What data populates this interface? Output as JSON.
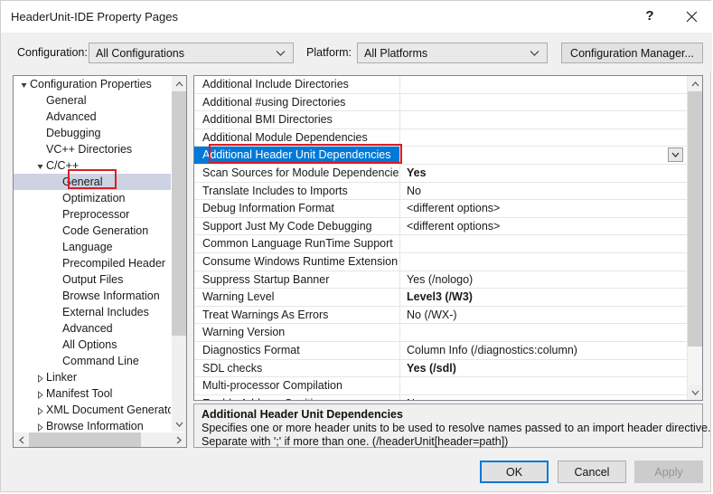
{
  "window": {
    "title": "HeaderUnit-IDE Property Pages",
    "help_glyph": "?",
    "close_glyph": "✕"
  },
  "config_bar": {
    "configuration_label": "Configuration:",
    "configuration_value": "All Configurations",
    "platform_label": "Platform:",
    "platform_value": "All Platforms",
    "configuration_manager_label": "Configuration Manager..."
  },
  "tree": {
    "items": [
      {
        "label": "Configuration Properties",
        "indent": 0,
        "twisty": "expanded",
        "selected": false
      },
      {
        "label": "General",
        "indent": 1,
        "twisty": "none",
        "selected": false
      },
      {
        "label": "Advanced",
        "indent": 1,
        "twisty": "none",
        "selected": false
      },
      {
        "label": "Debugging",
        "indent": 1,
        "twisty": "none",
        "selected": false
      },
      {
        "label": "VC++ Directories",
        "indent": 1,
        "twisty": "none",
        "selected": false
      },
      {
        "label": "C/C++",
        "indent": 1,
        "twisty": "expanded",
        "selected": false
      },
      {
        "label": "General",
        "indent": 2,
        "twisty": "none",
        "selected": true
      },
      {
        "label": "Optimization",
        "indent": 2,
        "twisty": "none",
        "selected": false
      },
      {
        "label": "Preprocessor",
        "indent": 2,
        "twisty": "none",
        "selected": false
      },
      {
        "label": "Code Generation",
        "indent": 2,
        "twisty": "none",
        "selected": false
      },
      {
        "label": "Language",
        "indent": 2,
        "twisty": "none",
        "selected": false
      },
      {
        "label": "Precompiled Header",
        "indent": 2,
        "twisty": "none",
        "selected": false
      },
      {
        "label": "Output Files",
        "indent": 2,
        "twisty": "none",
        "selected": false
      },
      {
        "label": "Browse Information",
        "indent": 2,
        "twisty": "none",
        "selected": false
      },
      {
        "label": "External Includes",
        "indent": 2,
        "twisty": "none",
        "selected": false
      },
      {
        "label": "Advanced",
        "indent": 2,
        "twisty": "none",
        "selected": false
      },
      {
        "label": "All Options",
        "indent": 2,
        "twisty": "none",
        "selected": false
      },
      {
        "label": "Command Line",
        "indent": 2,
        "twisty": "none",
        "selected": false
      },
      {
        "label": "Linker",
        "indent": 1,
        "twisty": "collapsed",
        "selected": false
      },
      {
        "label": "Manifest Tool",
        "indent": 1,
        "twisty": "collapsed",
        "selected": false
      },
      {
        "label": "XML Document Generator",
        "indent": 1,
        "twisty": "collapsed",
        "selected": false
      },
      {
        "label": "Browse Information",
        "indent": 1,
        "twisty": "collapsed",
        "selected": false
      }
    ]
  },
  "grid": {
    "rows": [
      {
        "name": "Additional Include Directories",
        "value": "",
        "bold": false,
        "selected": false
      },
      {
        "name": "Additional #using Directories",
        "value": "",
        "bold": false,
        "selected": false
      },
      {
        "name": "Additional BMI Directories",
        "value": "",
        "bold": false,
        "selected": false
      },
      {
        "name": "Additional Module Dependencies",
        "value": "",
        "bold": false,
        "selected": false
      },
      {
        "name": "Additional Header Unit Dependencies",
        "value": "",
        "bold": false,
        "selected": true
      },
      {
        "name": "Scan Sources for Module Dependencies",
        "value": "Yes",
        "bold": true,
        "selected": false
      },
      {
        "name": "Translate Includes to Imports",
        "value": "No",
        "bold": false,
        "selected": false
      },
      {
        "name": "Debug Information Format",
        "value": "<different options>",
        "bold": false,
        "selected": false
      },
      {
        "name": "Support Just My Code Debugging",
        "value": "<different options>",
        "bold": false,
        "selected": false
      },
      {
        "name": "Common Language RunTime Support",
        "value": "",
        "bold": false,
        "selected": false
      },
      {
        "name": "Consume Windows Runtime Extension",
        "value": "",
        "bold": false,
        "selected": false
      },
      {
        "name": "Suppress Startup Banner",
        "value": "Yes (/nologo)",
        "bold": false,
        "selected": false
      },
      {
        "name": "Warning Level",
        "value": "Level3 (/W3)",
        "bold": true,
        "selected": false
      },
      {
        "name": "Treat Warnings As Errors",
        "value": "No (/WX-)",
        "bold": false,
        "selected": false
      },
      {
        "name": "Warning Version",
        "value": "",
        "bold": false,
        "selected": false
      },
      {
        "name": "Diagnostics Format",
        "value": "Column Info (/diagnostics:column)",
        "bold": false,
        "selected": false
      },
      {
        "name": "SDL checks",
        "value": "Yes (/sdl)",
        "bold": true,
        "selected": false
      },
      {
        "name": "Multi-processor Compilation",
        "value": "",
        "bold": false,
        "selected": false
      },
      {
        "name": "Enable Address Sanitizer",
        "value": "No",
        "bold": false,
        "selected": false
      }
    ]
  },
  "description": {
    "title": "Additional Header Unit Dependencies",
    "line1": "Specifies one or more header units to be used to resolve names passed to an import header directive.",
    "line2": "Separate with ';' if more than one.  (/headerUnit[header=path])"
  },
  "footer": {
    "ok_label": "OK",
    "cancel_label": "Cancel",
    "apply_label": "Apply"
  },
  "colors": {
    "selection_blue": "#0078d7",
    "highlight_red": "#e01b24",
    "tree_selection": "#cdd3e3"
  }
}
